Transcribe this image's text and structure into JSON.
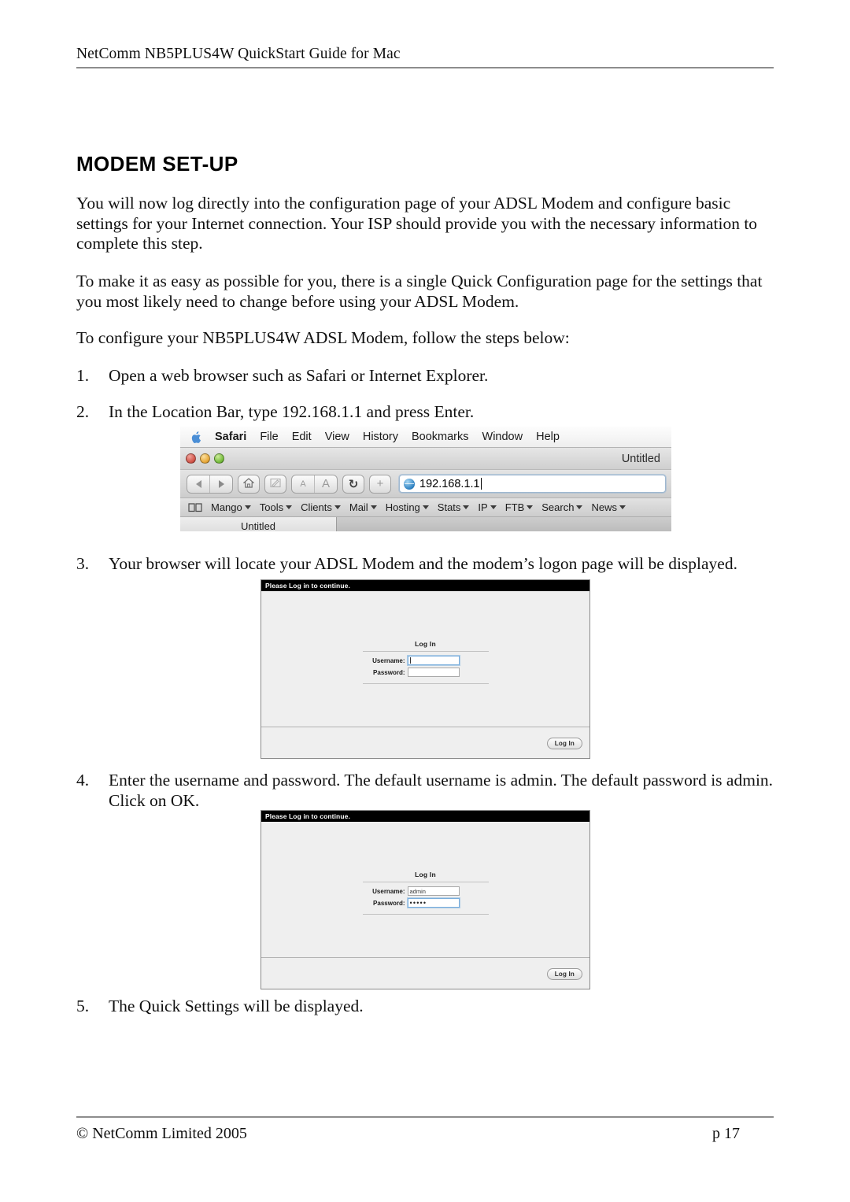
{
  "header": {
    "running_head": "NetComm NB5PLUS4W QuickStart Guide for Mac"
  },
  "main": {
    "title": "MODEM SET-UP",
    "paragraphs": [
      "You will now log directly into the configuration page of your ADSL Modem and configure basic settings for your Internet connection. Your ISP should provide you with the necessary information to complete this step.",
      "To make it as easy as possible for you, there is a single Quick Configuration page for the settings that you most likely need to change before using your ADSL Modem.",
      "To configure your  NB5PLUS4W ADSL Modem, follow the steps below:"
    ],
    "steps": [
      {
        "num": "1.",
        "text": "Open a web browser such as Safari or Internet Explorer."
      },
      {
        "num": "2.",
        "text": "In the Location Bar, type 192.168.1.1 and press Enter."
      },
      {
        "num": "3.",
        "text": "Your browser will locate your ADSL Modem and the modem’s logon page will be displayed."
      },
      {
        "num": "4.",
        "text": "Enter the username and password. The default username is admin. The default password is admin. Click on OK."
      },
      {
        "num": "5.",
        "text": "The Quick Settings will be displayed."
      }
    ]
  },
  "safari": {
    "menubar": [
      {
        "label": "Safari",
        "bold": true
      },
      {
        "label": "File",
        "bold": false
      },
      {
        "label": "Edit",
        "bold": false
      },
      {
        "label": "View",
        "bold": false
      },
      {
        "label": "History",
        "bold": false
      },
      {
        "label": "Bookmarks",
        "bold": false
      },
      {
        "label": "Window",
        "bold": false
      },
      {
        "label": "Help",
        "bold": false
      }
    ],
    "window_title": "Untitled",
    "traffic_lights": [
      {
        "name": "close",
        "color": "#d2554a"
      },
      {
        "name": "minimize",
        "color": "#e8a93a"
      },
      {
        "name": "zoom",
        "color": "#76bd3d"
      }
    ],
    "toolbar": {
      "back_icon": "triangle-left-icon",
      "forward_icon": "triangle-right-icon",
      "home_icon": "home-icon",
      "compose_icon": "compose-icon",
      "text_smaller": "A",
      "text_larger": "A",
      "reload_label": "↻",
      "add_label": "+"
    },
    "url": {
      "value": "192.168.1.1",
      "placeholder": "Enter address"
    },
    "bookmarks": [
      "Mango",
      "Tools",
      "Clients",
      "Mail",
      "Hosting",
      "Stats",
      "IP",
      "FTB",
      "Search",
      "News"
    ],
    "tab_label": "Untitled"
  },
  "login_empty": {
    "topbar": "Please Log in to continue.",
    "form_title": "Log In",
    "username_label": "Username:",
    "username_value": "",
    "password_label": "Password:",
    "password_value": "",
    "button_label": "Log In"
  },
  "login_filled": {
    "topbar": "Please Log in to continue.",
    "form_title": "Log In",
    "username_label": "Username:",
    "username_value": "admin",
    "password_label": "Password:",
    "password_value": "•••••",
    "button_label": "Log In"
  },
  "footer": {
    "copyright": "© NetComm Limited 2005",
    "page_number": "p 17"
  }
}
